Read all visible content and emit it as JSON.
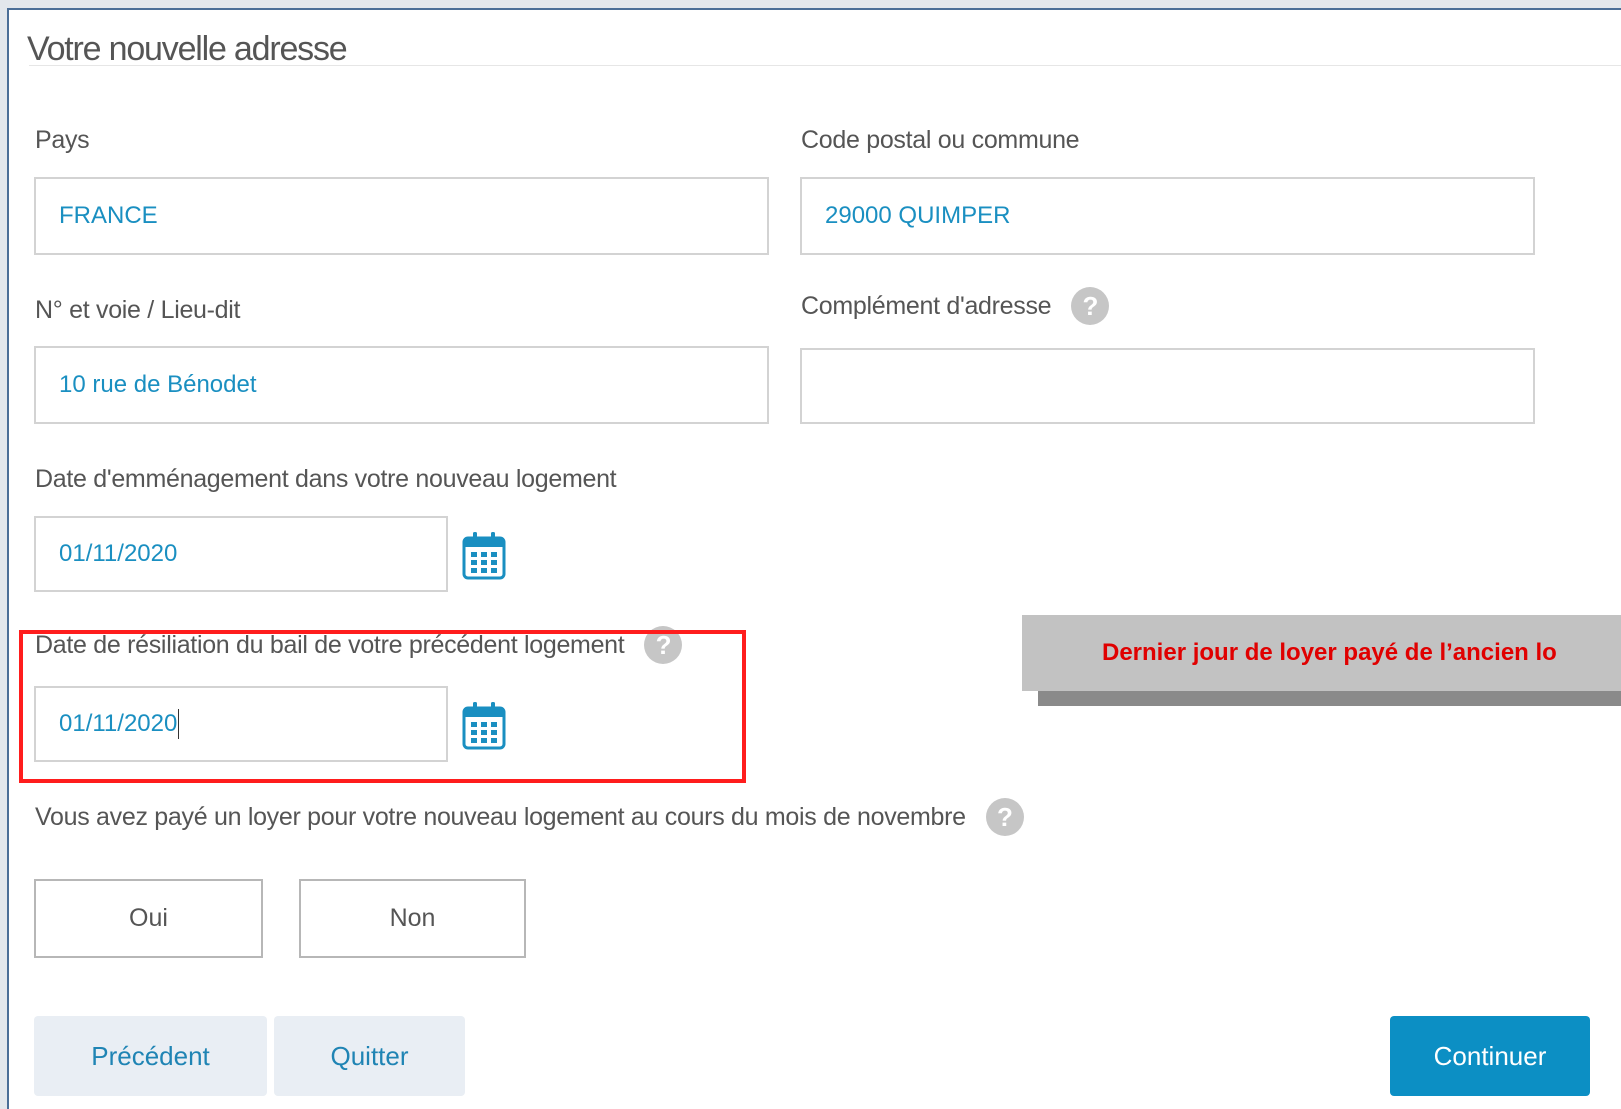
{
  "section": {
    "title": "Votre nouvelle adresse"
  },
  "fields": {
    "pays": {
      "label": "Pays",
      "value": "FRANCE"
    },
    "code_postal": {
      "label": "Code postal ou commune",
      "value": "29000 QUIMPER"
    },
    "voie": {
      "label": "N° et voie / Lieu-dit",
      "value": "10 rue de Bénodet"
    },
    "complement": {
      "label": "Complément d'adresse",
      "value": ""
    },
    "date_emmenagement": {
      "label": "Date d'emménagement dans votre nouveau logement",
      "value": "01/11/2020"
    },
    "date_resiliation": {
      "label": "Date de résiliation du bail de votre précédent logement",
      "value": "01/11/2020"
    }
  },
  "question": {
    "label": "Vous avez payé un loyer pour votre nouveau logement au cours du mois de novembre",
    "options": [
      "Oui",
      "Non"
    ]
  },
  "callout": {
    "text": "Dernier jour de loyer payé de l’ancien lo"
  },
  "buttons": {
    "precedent": "Précédent",
    "quitter": "Quitter",
    "continuer": "Continuer"
  },
  "icons": {
    "help": "question-circle-icon",
    "calendar": "calendar-icon"
  },
  "colors": {
    "value_text": "#1a8fc1",
    "primary_button": "#0c8fc4",
    "highlight_border": "#ff1d1d",
    "callout_text": "#e00000",
    "secondary_button_bg": "#e9eef4"
  }
}
